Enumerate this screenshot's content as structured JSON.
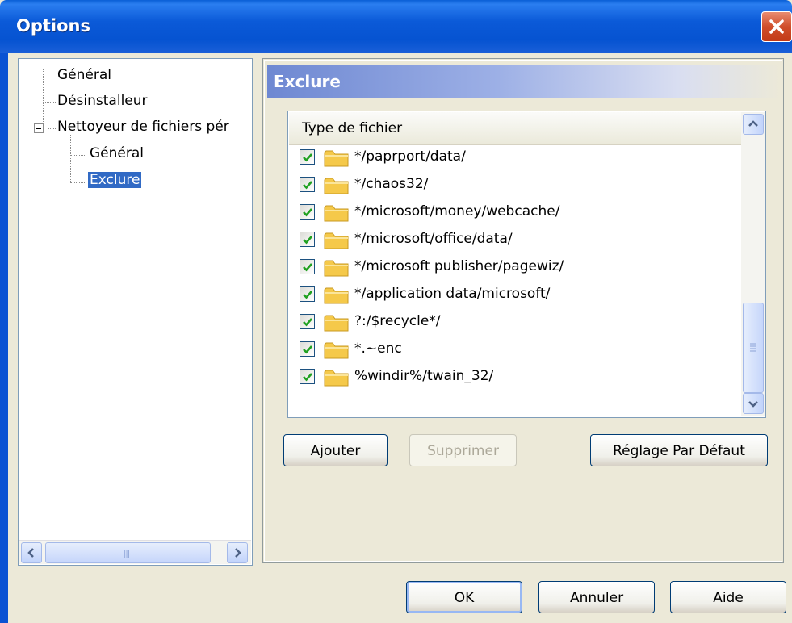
{
  "window": {
    "title": "Options"
  },
  "tree": {
    "items": [
      {
        "label": "Général"
      },
      {
        "label": "Désinstalleur"
      },
      {
        "label": "Nettoyeur de fichiers pér"
      },
      {
        "label": "Général"
      },
      {
        "label": "Exclure"
      }
    ],
    "selected": "Exclure"
  },
  "page": {
    "header": "Exclure",
    "list": {
      "column_header": "Type de fichier",
      "rows": [
        {
          "label": "*/paprport/data/",
          "checked": true
        },
        {
          "label": "*/chaos32/",
          "checked": true
        },
        {
          "label": "*/microsoft/money/webcache/",
          "checked": true
        },
        {
          "label": "*/microsoft/office/data/",
          "checked": true
        },
        {
          "label": "*/microsoft publisher/pagewiz/",
          "checked": true
        },
        {
          "label": "*/application data/microsoft/",
          "checked": true
        },
        {
          "label": "?:/$recycle*/",
          "checked": true
        },
        {
          "label": "*.~enc",
          "checked": true
        },
        {
          "label": "%windir%/twain_32/",
          "checked": true
        }
      ]
    },
    "buttons": {
      "add": "Ajouter",
      "remove": "Supprimer",
      "defaults": "Réglage Par Défaut"
    }
  },
  "footer": {
    "ok": "OK",
    "cancel": "Annuler",
    "help": "Aide"
  },
  "colors": {
    "titlebar": "#0a5fd6",
    "selection": "#316ac5",
    "checkmark": "#21a121",
    "folder": "#f5c94a"
  }
}
